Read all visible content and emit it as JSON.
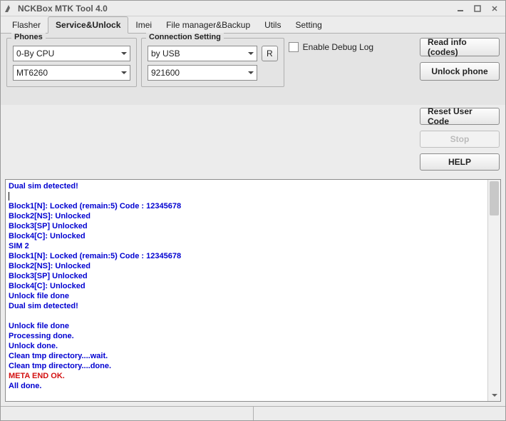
{
  "window": {
    "title": "NCKBox MTK Tool 4.0"
  },
  "tabs": [
    "Flasher",
    "Service&Unlock",
    "Imei",
    "File manager&Backup",
    "Utils",
    "Setting"
  ],
  "active_tab_index": 1,
  "phones": {
    "legend": "Phones",
    "mode": "0-By CPU",
    "cpu": "MT6260"
  },
  "connection": {
    "legend": "Connection Setting",
    "method": "by USB",
    "baud": "921600",
    "r_button": "R"
  },
  "debug": {
    "label": "Enable Debug Log",
    "checked": false
  },
  "buttons": {
    "read_info": "Read info (codes)",
    "unlock": "Unlock phone",
    "reset_user": "Reset User Code",
    "stop": "Stop",
    "help": "HELP"
  },
  "log": [
    {
      "text": "Dual sim detected!",
      "color": "blue"
    },
    {
      "text": "",
      "color": "blue",
      "cursor": true
    },
    {
      "text": "Block1[N]: Locked (remain:5) Code : 12345678",
      "color": "blue"
    },
    {
      "text": "Block2[NS]: Unlocked",
      "color": "blue"
    },
    {
      "text": "Block3[SP] Unlocked",
      "color": "blue"
    },
    {
      "text": "Block4[C]: Unlocked",
      "color": "blue"
    },
    {
      "text": "SIM 2",
      "color": "blue"
    },
    {
      "text": "Block1[N]: Locked (remain:5) Code : 12345678",
      "color": "blue"
    },
    {
      "text": "Block2[NS]: Unlocked",
      "color": "blue"
    },
    {
      "text": "Block3[SP] Unlocked",
      "color": "blue"
    },
    {
      "text": "Block4[C]: Unlocked",
      "color": "blue"
    },
    {
      "text": "Unlock file done",
      "color": "blue"
    },
    {
      "text": "Dual sim detected!",
      "color": "blue"
    },
    {
      "text": "",
      "color": "blue"
    },
    {
      "text": "Unlock file done",
      "color": "blue"
    },
    {
      "text": "Processing done.",
      "color": "blue"
    },
    {
      "text": "Unlock done.",
      "color": "blue"
    },
    {
      "text": "Clean tmp directory....wait.",
      "color": "blue"
    },
    {
      "text": "Clean tmp directory....done.",
      "color": "blue"
    },
    {
      "text": "META END OK.",
      "color": "red"
    },
    {
      "text": "All done.",
      "color": "blue"
    }
  ]
}
